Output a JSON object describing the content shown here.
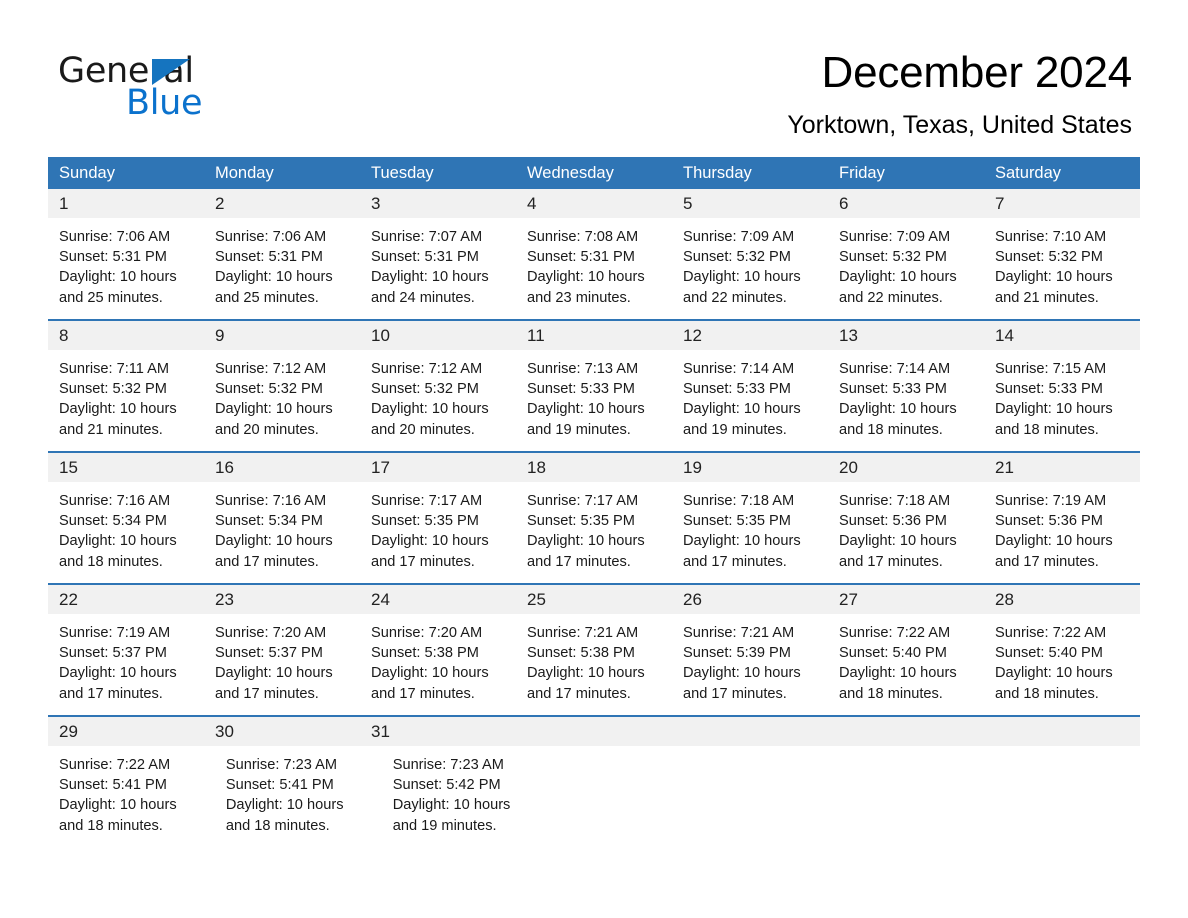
{
  "brand": {
    "name_part1": "General",
    "name_part2": "Blue",
    "triangle_color": "#1574bf",
    "blue_color": "#0b72cd"
  },
  "header": {
    "month_title": "December 2024",
    "location": "Yorktown, Texas, United States"
  },
  "theme": {
    "header_blue": "#2f75b5",
    "daynum_band": "#f1f1f1",
    "separator_blue": "#2f75b5",
    "text_color": "#1a1a1a"
  },
  "weekdays": [
    "Sunday",
    "Monday",
    "Tuesday",
    "Wednesday",
    "Thursday",
    "Friday",
    "Saturday"
  ],
  "weeks": [
    {
      "days": [
        {
          "num": "1",
          "sunrise": "Sunrise: 7:06 AM",
          "sunset": "Sunset: 5:31 PM",
          "daylight_1": "Daylight: 10 hours",
          "daylight_2": "and 25 minutes."
        },
        {
          "num": "2",
          "sunrise": "Sunrise: 7:06 AM",
          "sunset": "Sunset: 5:31 PM",
          "daylight_1": "Daylight: 10 hours",
          "daylight_2": "and 25 minutes."
        },
        {
          "num": "3",
          "sunrise": "Sunrise: 7:07 AM",
          "sunset": "Sunset: 5:31 PM",
          "daylight_1": "Daylight: 10 hours",
          "daylight_2": "and 24 minutes."
        },
        {
          "num": "4",
          "sunrise": "Sunrise: 7:08 AM",
          "sunset": "Sunset: 5:31 PM",
          "daylight_1": "Daylight: 10 hours",
          "daylight_2": "and 23 minutes."
        },
        {
          "num": "5",
          "sunrise": "Sunrise: 7:09 AM",
          "sunset": "Sunset: 5:32 PM",
          "daylight_1": "Daylight: 10 hours",
          "daylight_2": "and 22 minutes."
        },
        {
          "num": "6",
          "sunrise": "Sunrise: 7:09 AM",
          "sunset": "Sunset: 5:32 PM",
          "daylight_1": "Daylight: 10 hours",
          "daylight_2": "and 22 minutes."
        },
        {
          "num": "7",
          "sunrise": "Sunrise: 7:10 AM",
          "sunset": "Sunset: 5:32 PM",
          "daylight_1": "Daylight: 10 hours",
          "daylight_2": "and 21 minutes."
        }
      ]
    },
    {
      "days": [
        {
          "num": "8",
          "sunrise": "Sunrise: 7:11 AM",
          "sunset": "Sunset: 5:32 PM",
          "daylight_1": "Daylight: 10 hours",
          "daylight_2": "and 21 minutes."
        },
        {
          "num": "9",
          "sunrise": "Sunrise: 7:12 AM",
          "sunset": "Sunset: 5:32 PM",
          "daylight_1": "Daylight: 10 hours",
          "daylight_2": "and 20 minutes."
        },
        {
          "num": "10",
          "sunrise": "Sunrise: 7:12 AM",
          "sunset": "Sunset: 5:32 PM",
          "daylight_1": "Daylight: 10 hours",
          "daylight_2": "and 20 minutes."
        },
        {
          "num": "11",
          "sunrise": "Sunrise: 7:13 AM",
          "sunset": "Sunset: 5:33 PM",
          "daylight_1": "Daylight: 10 hours",
          "daylight_2": "and 19 minutes."
        },
        {
          "num": "12",
          "sunrise": "Sunrise: 7:14 AM",
          "sunset": "Sunset: 5:33 PM",
          "daylight_1": "Daylight: 10 hours",
          "daylight_2": "and 19 minutes."
        },
        {
          "num": "13",
          "sunrise": "Sunrise: 7:14 AM",
          "sunset": "Sunset: 5:33 PM",
          "daylight_1": "Daylight: 10 hours",
          "daylight_2": "and 18 minutes."
        },
        {
          "num": "14",
          "sunrise": "Sunrise: 7:15 AM",
          "sunset": "Sunset: 5:33 PM",
          "daylight_1": "Daylight: 10 hours",
          "daylight_2": "and 18 minutes."
        }
      ]
    },
    {
      "days": [
        {
          "num": "15",
          "sunrise": "Sunrise: 7:16 AM",
          "sunset": "Sunset: 5:34 PM",
          "daylight_1": "Daylight: 10 hours",
          "daylight_2": "and 18 minutes."
        },
        {
          "num": "16",
          "sunrise": "Sunrise: 7:16 AM",
          "sunset": "Sunset: 5:34 PM",
          "daylight_1": "Daylight: 10 hours",
          "daylight_2": "and 17 minutes."
        },
        {
          "num": "17",
          "sunrise": "Sunrise: 7:17 AM",
          "sunset": "Sunset: 5:35 PM",
          "daylight_1": "Daylight: 10 hours",
          "daylight_2": "and 17 minutes."
        },
        {
          "num": "18",
          "sunrise": "Sunrise: 7:17 AM",
          "sunset": "Sunset: 5:35 PM",
          "daylight_1": "Daylight: 10 hours",
          "daylight_2": "and 17 minutes."
        },
        {
          "num": "19",
          "sunrise": "Sunrise: 7:18 AM",
          "sunset": "Sunset: 5:35 PM",
          "daylight_1": "Daylight: 10 hours",
          "daylight_2": "and 17 minutes."
        },
        {
          "num": "20",
          "sunrise": "Sunrise: 7:18 AM",
          "sunset": "Sunset: 5:36 PM",
          "daylight_1": "Daylight: 10 hours",
          "daylight_2": "and 17 minutes."
        },
        {
          "num": "21",
          "sunrise": "Sunrise: 7:19 AM",
          "sunset": "Sunset: 5:36 PM",
          "daylight_1": "Daylight: 10 hours",
          "daylight_2": "and 17 minutes."
        }
      ]
    },
    {
      "days": [
        {
          "num": "22",
          "sunrise": "Sunrise: 7:19 AM",
          "sunset": "Sunset: 5:37 PM",
          "daylight_1": "Daylight: 10 hours",
          "daylight_2": "and 17 minutes."
        },
        {
          "num": "23",
          "sunrise": "Sunrise: 7:20 AM",
          "sunset": "Sunset: 5:37 PM",
          "daylight_1": "Daylight: 10 hours",
          "daylight_2": "and 17 minutes."
        },
        {
          "num": "24",
          "sunrise": "Sunrise: 7:20 AM",
          "sunset": "Sunset: 5:38 PM",
          "daylight_1": "Daylight: 10 hours",
          "daylight_2": "and 17 minutes."
        },
        {
          "num": "25",
          "sunrise": "Sunrise: 7:21 AM",
          "sunset": "Sunset: 5:38 PM",
          "daylight_1": "Daylight: 10 hours",
          "daylight_2": "and 17 minutes."
        },
        {
          "num": "26",
          "sunrise": "Sunrise: 7:21 AM",
          "sunset": "Sunset: 5:39 PM",
          "daylight_1": "Daylight: 10 hours",
          "daylight_2": "and 17 minutes."
        },
        {
          "num": "27",
          "sunrise": "Sunrise: 7:22 AM",
          "sunset": "Sunset: 5:40 PM",
          "daylight_1": "Daylight: 10 hours",
          "daylight_2": "and 18 minutes."
        },
        {
          "num": "28",
          "sunrise": "Sunrise: 7:22 AM",
          "sunset": "Sunset: 5:40 PM",
          "daylight_1": "Daylight: 10 hours",
          "daylight_2": "and 18 minutes."
        }
      ]
    },
    {
      "days": [
        {
          "num": "29",
          "sunrise": "Sunrise: 7:22 AM",
          "sunset": "Sunset: 5:41 PM",
          "daylight_1": "Daylight: 10 hours",
          "daylight_2": "and 18 minutes."
        },
        {
          "num": "30",
          "sunrise": "Sunrise: 7:23 AM",
          "sunset": "Sunset: 5:41 PM",
          "daylight_1": "Daylight: 10 hours",
          "daylight_2": "and 18 minutes."
        },
        {
          "num": "31",
          "sunrise": "Sunrise: 7:23 AM",
          "sunset": "Sunset: 5:42 PM",
          "daylight_1": "Daylight: 10 hours",
          "daylight_2": "and 19 minutes."
        },
        {
          "num": "",
          "sunrise": "",
          "sunset": "",
          "daylight_1": "",
          "daylight_2": ""
        },
        {
          "num": "",
          "sunrise": "",
          "sunset": "",
          "daylight_1": "",
          "daylight_2": ""
        },
        {
          "num": "",
          "sunrise": "",
          "sunset": "",
          "daylight_1": "",
          "daylight_2": ""
        },
        {
          "num": "",
          "sunrise": "",
          "sunset": "",
          "daylight_1": "",
          "daylight_2": ""
        }
      ]
    }
  ]
}
